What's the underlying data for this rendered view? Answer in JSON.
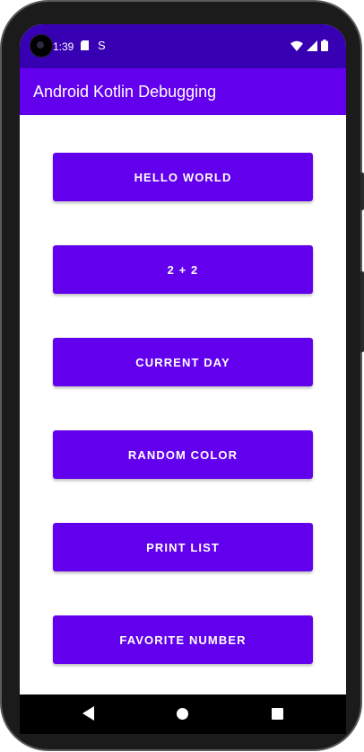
{
  "status_bar": {
    "time": "1:39",
    "sd_icon": "sd-card-icon",
    "s_icon_text": "S",
    "wifi_icon": "wifi-icon",
    "signal_icon": "signal-icon",
    "battery_icon": "battery-icon",
    "background": "#3700b3"
  },
  "app_bar": {
    "title": "Android Kotlin Debugging",
    "background": "#6200ee"
  },
  "buttons": [
    {
      "label": "HELLO WORLD"
    },
    {
      "label": "2 + 2"
    },
    {
      "label": "CURRENT DAY"
    },
    {
      "label": "RANDOM COLOR"
    },
    {
      "label": "PRINT LIST"
    },
    {
      "label": "FAVORITE NUMBER"
    }
  ],
  "button_color": "#6200ee",
  "nav_bar": {
    "back_icon": "back-triangle-icon",
    "home_icon": "home-circle-icon",
    "recents_icon": "recents-square-icon"
  }
}
